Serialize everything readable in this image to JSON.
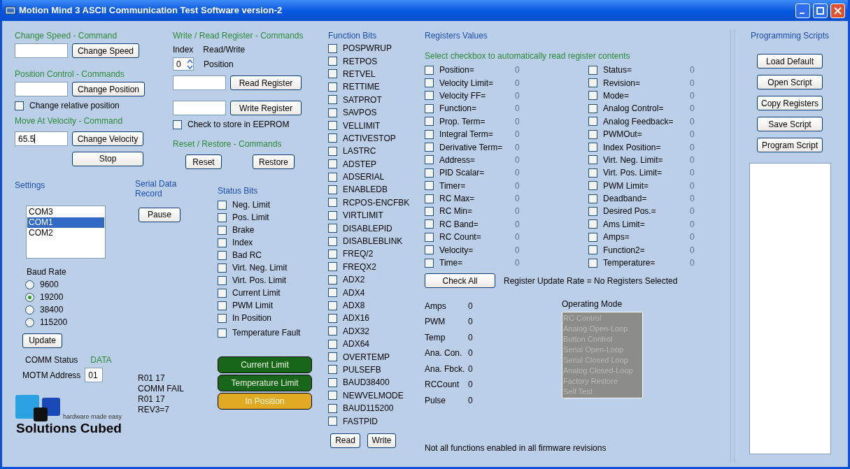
{
  "window": {
    "title": "Motion Mind 3 ASCII Communication Test Software version-2"
  },
  "change_speed": {
    "title": "Change Speed - Command",
    "button": "Change Speed"
  },
  "position_control": {
    "title": "Position Control - Commands",
    "button": "Change Position",
    "relative": {
      "label": "Change relative position",
      "checked": false
    }
  },
  "move_at_velocity": {
    "title": "Move At Velocity - Command",
    "value": "65.5",
    "button": "Change Velocity",
    "stop": "Stop"
  },
  "register_commands": {
    "title": "Write / Read Register - Commands",
    "index_label": "Index",
    "rw_label": "Read/Write",
    "index_value": "0",
    "register_name": "Position",
    "read_button": "Read Register",
    "write_button": "Write Register",
    "eeprom": {
      "label": "Check to store in EEPROM",
      "checked": false
    }
  },
  "reset_restore": {
    "title": "Reset  / Restore - Commands",
    "reset": "Reset",
    "restore": "Restore"
  },
  "settings": {
    "title": "Settings",
    "ports": [
      {
        "label": "COM3",
        "selected": false
      },
      {
        "label": "COM1",
        "selected": true
      },
      {
        "label": "COM2",
        "selected": false
      }
    ],
    "baud_label": "Baud Rate",
    "baud_rates": [
      {
        "label": "9600",
        "selected": false
      },
      {
        "label": "19200",
        "selected": true
      },
      {
        "label": "38400",
        "selected": false
      },
      {
        "label": "115200",
        "selected": false
      }
    ],
    "update": "Update",
    "comm_status_label": "COMM Status",
    "comm_status": "DATA",
    "address_label": "MOTM Address",
    "address": "01"
  },
  "serial_record": {
    "title": "Serial Data Record",
    "pause": "Pause",
    "lines": [
      "R01 17",
      "COMM FAIL",
      "R01 17",
      "REV3=7"
    ]
  },
  "status_bits": {
    "title": "Status Bits",
    "items": [
      {
        "label": "Neg. Limit",
        "checked": false
      },
      {
        "label": "Pos. Limit",
        "checked": false
      },
      {
        "label": "Brake",
        "checked": false
      },
      {
        "label": "Index",
        "checked": false
      },
      {
        "label": "Bad RC",
        "checked": false
      },
      {
        "label": "Virt. Neg. Limit",
        "checked": false
      },
      {
        "label": "Virt. Pos. Limit",
        "checked": false
      },
      {
        "label": "Current Limit",
        "checked": false
      },
      {
        "label": "PWM Limit",
        "checked": false
      },
      {
        "label": "In Position",
        "checked": false
      },
      {
        "label": "Temperature Fault",
        "checked": false
      }
    ],
    "indicators": [
      {
        "label": "Current Limit",
        "color": "#17661a"
      },
      {
        "label": "Temperature Limit",
        "color": "#17661a"
      },
      {
        "label": "In Position",
        "color": "#e0aa22"
      }
    ]
  },
  "logo": {
    "tagline": "hardware made easy",
    "name": "Solutions Cubed"
  },
  "function_bits": {
    "title": "Function Bits",
    "items": [
      {
        "label": "POSPWRUP",
        "checked": false
      },
      {
        "label": "RETPOS",
        "checked": false
      },
      {
        "label": "RETVEL",
        "checked": false
      },
      {
        "label": "RETTIME",
        "checked": false
      },
      {
        "label": "SATPROT",
        "checked": false
      },
      {
        "label": "SAVPOS",
        "checked": false
      },
      {
        "label": "VELLIMIT",
        "checked": false
      },
      {
        "label": "ACTIVESTOP",
        "checked": false
      },
      {
        "label": "LASTRC",
        "checked": false
      },
      {
        "label": "ADSTEP",
        "checked": false
      },
      {
        "label": "ADSERIAL",
        "checked": false
      },
      {
        "label": "ENABLEDB",
        "checked": false
      },
      {
        "label": "RCPOS-ENCFBK",
        "checked": false
      },
      {
        "label": "VIRTLIMIT",
        "checked": false
      },
      {
        "label": "DISABLEPID",
        "checked": false
      },
      {
        "label": "DISABLEBLINK",
        "checked": false
      },
      {
        "label": "FREQ/2",
        "checked": false
      },
      {
        "label": "FREQX2",
        "checked": false
      },
      {
        "label": "ADX2",
        "checked": false
      },
      {
        "label": "ADX4",
        "checked": false
      },
      {
        "label": "ADX8",
        "checked": false
      },
      {
        "label": "ADX16",
        "checked": false
      },
      {
        "label": "ADX32",
        "checked": false
      },
      {
        "label": "ADX64",
        "checked": false
      },
      {
        "label": "OVERTEMP",
        "checked": false
      },
      {
        "label": "PULSEFB",
        "checked": false
      },
      {
        "label": "BAUD38400",
        "checked": false
      },
      {
        "label": "NEWVELMODE",
        "checked": false
      },
      {
        "label": "BAUD115200",
        "checked": false
      },
      {
        "label": "FASTPID",
        "checked": false
      }
    ],
    "read": "Read",
    "write": "Write"
  },
  "registers": {
    "title": "Registers Values",
    "hint": "Select checkbox to automatically read register contents",
    "left": [
      {
        "label": "Position=",
        "value": "0",
        "checked": false
      },
      {
        "label": "Velocity Limit=",
        "value": "0",
        "checked": false
      },
      {
        "label": "Velocity FF=",
        "value": "0",
        "checked": false
      },
      {
        "label": "Function=",
        "value": "0",
        "checked": false
      },
      {
        "label": "Prop. Term=",
        "value": "0",
        "checked": false
      },
      {
        "label": "Integral Term=",
        "value": "0",
        "checked": false
      },
      {
        "label": "Derivative Term=",
        "value": "0",
        "checked": false
      },
      {
        "label": "Address=",
        "value": "0",
        "checked": false
      },
      {
        "label": "PID Scalar=",
        "value": "0",
        "checked": false
      },
      {
        "label": "Timer=",
        "value": "0",
        "checked": false
      },
      {
        "label": "RC Max=",
        "value": "0",
        "checked": false
      },
      {
        "label": "RC Min=",
        "value": "0",
        "checked": false
      },
      {
        "label": "RC Band=",
        "value": "0",
        "checked": false
      },
      {
        "label": "RC Count=",
        "value": "0",
        "checked": false
      },
      {
        "label": "Velocity=",
        "value": "0",
        "checked": false
      },
      {
        "label": "Time=",
        "value": "0",
        "checked": false
      }
    ],
    "right": [
      {
        "label": "Status=",
        "value": "0",
        "checked": false
      },
      {
        "label": "Revision=",
        "value": "0",
        "checked": false
      },
      {
        "label": "Mode=",
        "value": "0",
        "checked": false
      },
      {
        "label": "Analog Control=",
        "value": "0",
        "checked": false
      },
      {
        "label": "Analog Feedback=",
        "value": "0",
        "checked": false
      },
      {
        "label": "PWMOut=",
        "value": "0",
        "checked": false
      },
      {
        "label": "Index Position=",
        "value": "0",
        "checked": false
      },
      {
        "label": "Virt. Neg. Limit=",
        "value": "0",
        "checked": false
      },
      {
        "label": "Virt. Pos. Limit=",
        "value": "0",
        "checked": false
      },
      {
        "label": "PWM Limit=",
        "value": "0",
        "checked": false
      },
      {
        "label": "Deadband=",
        "value": "0",
        "checked": false
      },
      {
        "label": "Desired Pos.=",
        "value": "0",
        "checked": false
      },
      {
        "label": "Ams Limit=",
        "value": "0",
        "checked": false
      },
      {
        "label": "Amps=",
        "value": "0",
        "checked": false
      },
      {
        "label": "Function2=",
        "value": "0",
        "checked": false
      },
      {
        "label": "Temperature=",
        "value": "0",
        "checked": false
      }
    ],
    "check_all": "Check All",
    "update_rate": "Register Update Rate = No Registers Selected"
  },
  "readings": [
    {
      "label": "Amps",
      "value": "0"
    },
    {
      "label": "PWM",
      "value": "0"
    },
    {
      "label": "Temp",
      "value": "0"
    },
    {
      "label": "Ana. Con.",
      "value": "0"
    },
    {
      "label": "Ana. Fbck.",
      "value": "0"
    },
    {
      "label": "RCCount",
      "value": "0"
    },
    {
      "label": "Pulse",
      "value": "0"
    }
  ],
  "operating_mode": {
    "title": "Operating Mode",
    "disabled": true,
    "items": [
      "RC Control",
      "Analog Open-Loop",
      "Button Control",
      "Serial Open-Loop",
      "Serial Closed Loop",
      "Analog Closed-Loop",
      "Factory Restore",
      "Self Test"
    ]
  },
  "footnote": "Not all functions enabled in all firmware revisions",
  "scripts": {
    "title": "Programming Scripts",
    "buttons": [
      "Load Default",
      "Open Script",
      "Copy Registers",
      "Save Script",
      "Program Script"
    ]
  }
}
